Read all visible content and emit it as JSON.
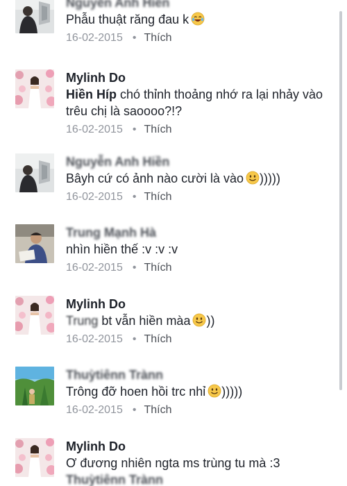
{
  "comments": [
    {
      "author": "Nguyễn Anh Hiền",
      "author_blurred": true,
      "avatar": "man-in-dark-jacket",
      "mention": "",
      "text": "Phẫu thuật răng đau k",
      "emoji": "laughing-tears-emoji",
      "date": "16-02-2015",
      "like": "Thích"
    },
    {
      "author": "Mylinh Do",
      "author_blurred": false,
      "avatar": "woman-in-white-dress-flowers",
      "mention": "Hiền Híp",
      "text": "chó thỉnh thoảng nhớ ra lại nhảy vào trêu chị là saoooo?!?",
      "emoji": "",
      "date": "16-02-2015",
      "like": "Thích"
    },
    {
      "author": "Nguyễn Anh Hiền",
      "author_blurred": true,
      "avatar": "man-in-dark-jacket",
      "mention": "",
      "text": "Bâyh cứ có ảnh nào cười là vào",
      "emoji": "smiley-emoji",
      "text_after": ")))))",
      "date": "16-02-2015",
      "like": "Thích"
    },
    {
      "author": "Trung Mạnh Hà",
      "author_blurred": true,
      "avatar": "man-reading",
      "mention": "",
      "text": "nhìn hiền thế :v :v :v",
      "emoji": "",
      "date": "16-02-2015",
      "like": "Thích"
    },
    {
      "author": "Mylinh Do",
      "author_blurred": false,
      "avatar": "woman-in-white-dress-flowers",
      "mention": "Trung",
      "mention_blurred": true,
      "text": "bt vẫn hiền màa",
      "emoji": "smiley-emoji",
      "text_after": "))",
      "date": "16-02-2015",
      "like": "Thích"
    },
    {
      "author": "Thuỳtiênn Trànn",
      "author_blurred": true,
      "avatar": "outdoor-garden-sky",
      "mention": "",
      "text": "Trông đỡ hoen hồi trc nhỉ",
      "emoji": "smiley-emoji",
      "text_after": ")))))",
      "date": "16-02-2015",
      "like": "Thích"
    },
    {
      "author": "Mylinh Do",
      "author_blurred": false,
      "avatar": "woman-in-white-dress-flowers",
      "mention": "",
      "text": "Ơ đương nhiên ngta ms trùng tu mà :3",
      "emoji": "",
      "date": "",
      "like": "",
      "reply_preview_author": "Thuỳtiênn Trànn"
    }
  ]
}
